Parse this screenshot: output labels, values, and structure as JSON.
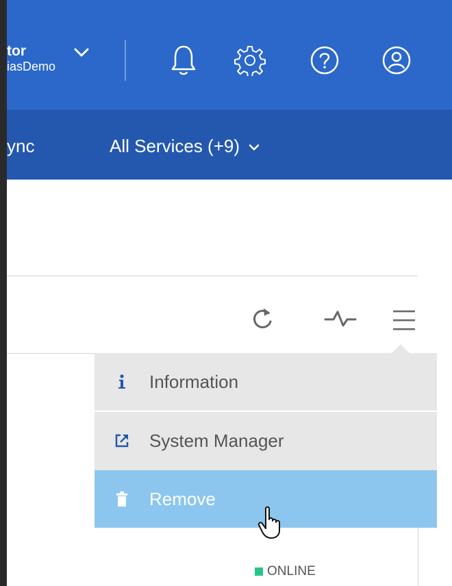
{
  "header": {
    "user_role": "tor",
    "account": "iasDemo"
  },
  "nav": {
    "items": [
      "ync",
      "All Services (+9)"
    ]
  },
  "menu": {
    "items": [
      {
        "label": "Information",
        "icon": "info-icon"
      },
      {
        "label": "System Manager",
        "icon": "external-link-icon"
      },
      {
        "label": "Remove",
        "icon": "trash-icon"
      }
    ]
  },
  "status": {
    "label": "ONLINE",
    "color": "#28c48a"
  },
  "colors": {
    "topbar": "#2b68c9",
    "navbar": "#2458ae",
    "menu_bg": "#e7e7e7",
    "menu_active": "#8cc6ee"
  }
}
